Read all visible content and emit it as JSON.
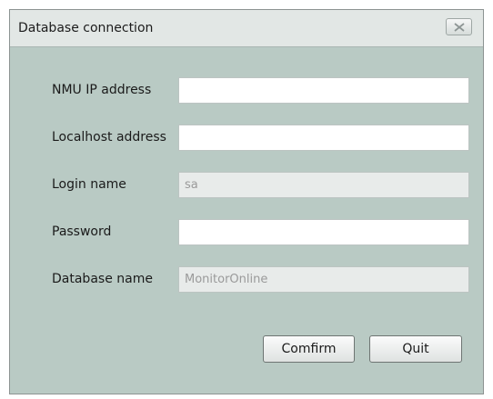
{
  "window": {
    "title": "Database connection",
    "close_icon": "close-x-icon"
  },
  "form": {
    "nmu_ip": {
      "label": "NMU IP address",
      "value": ""
    },
    "localhost": {
      "label": "Localhost address",
      "value": ""
    },
    "login_name": {
      "label": "Login name",
      "value": "sa"
    },
    "password": {
      "label": "Password",
      "value": ""
    },
    "database_name": {
      "label": "Database name",
      "value": "MonitorOnline"
    }
  },
  "buttons": {
    "confirm_label": "Comfirm",
    "quit_label": "Quit"
  },
  "colors": {
    "dialog_background": "#b9cac4",
    "titlebar_background": "#e2e7e5",
    "disabled_field_background": "#e8ebea"
  }
}
